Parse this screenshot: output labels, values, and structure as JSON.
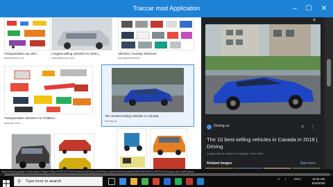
{
  "window": {
    "title": "Traccar mod Application",
    "min": "–",
    "max": "☐",
    "close": "✕"
  },
  "results": [
    {
      "caption": "Transportation car vehi...",
      "source": "sketchpoint.com"
    },
    {
      "caption": "Longest-selling vehicles for 2018 |...",
      "source": "carsandtrucks.com"
    },
    {
      "caption": "Vehicles | Sunday Observer",
      "source": "sundayobserver.lk"
    },
    {
      "caption": "Transportation Vehicles For Children...",
      "source": "youtube.com"
    },
    {
      "caption": "The 10 best-selling vehicles in Canada...",
      "source": "driving.ca"
    },
    {
      "caption": "",
      "source": ""
    },
    {
      "caption": "",
      "source": ""
    },
    {
      "caption": "",
      "source": ""
    }
  ],
  "panel": {
    "close": "✕",
    "source": "Driving.ca",
    "share_icon": "share-icon",
    "more_icon": "more-icon",
    "title": "The 10 best-selling vehicles in Canada in 2018 | Driving",
    "subtitle": "Images may be subject to copyright. Learn More",
    "related": "Related images",
    "see_more": "See more"
  },
  "statusbar": {
    "url": "https://www.google.com/imgres?imgurl=https%3A%2F%2Fsmartcdn.driving.ca%2Fwp-content%2Fuploads%2F2018%2F01%2F2018-honda-civic-hatchback..."
  },
  "taskbar": {
    "search_placeholder": "Type here to search",
    "lang": "ENG",
    "time": "10:42 AM",
    "date": "8/16/2020"
  },
  "colors": {
    "titlebar": "#1e82d6",
    "panel_bg": "#202124",
    "link": "#8ab4f8"
  }
}
